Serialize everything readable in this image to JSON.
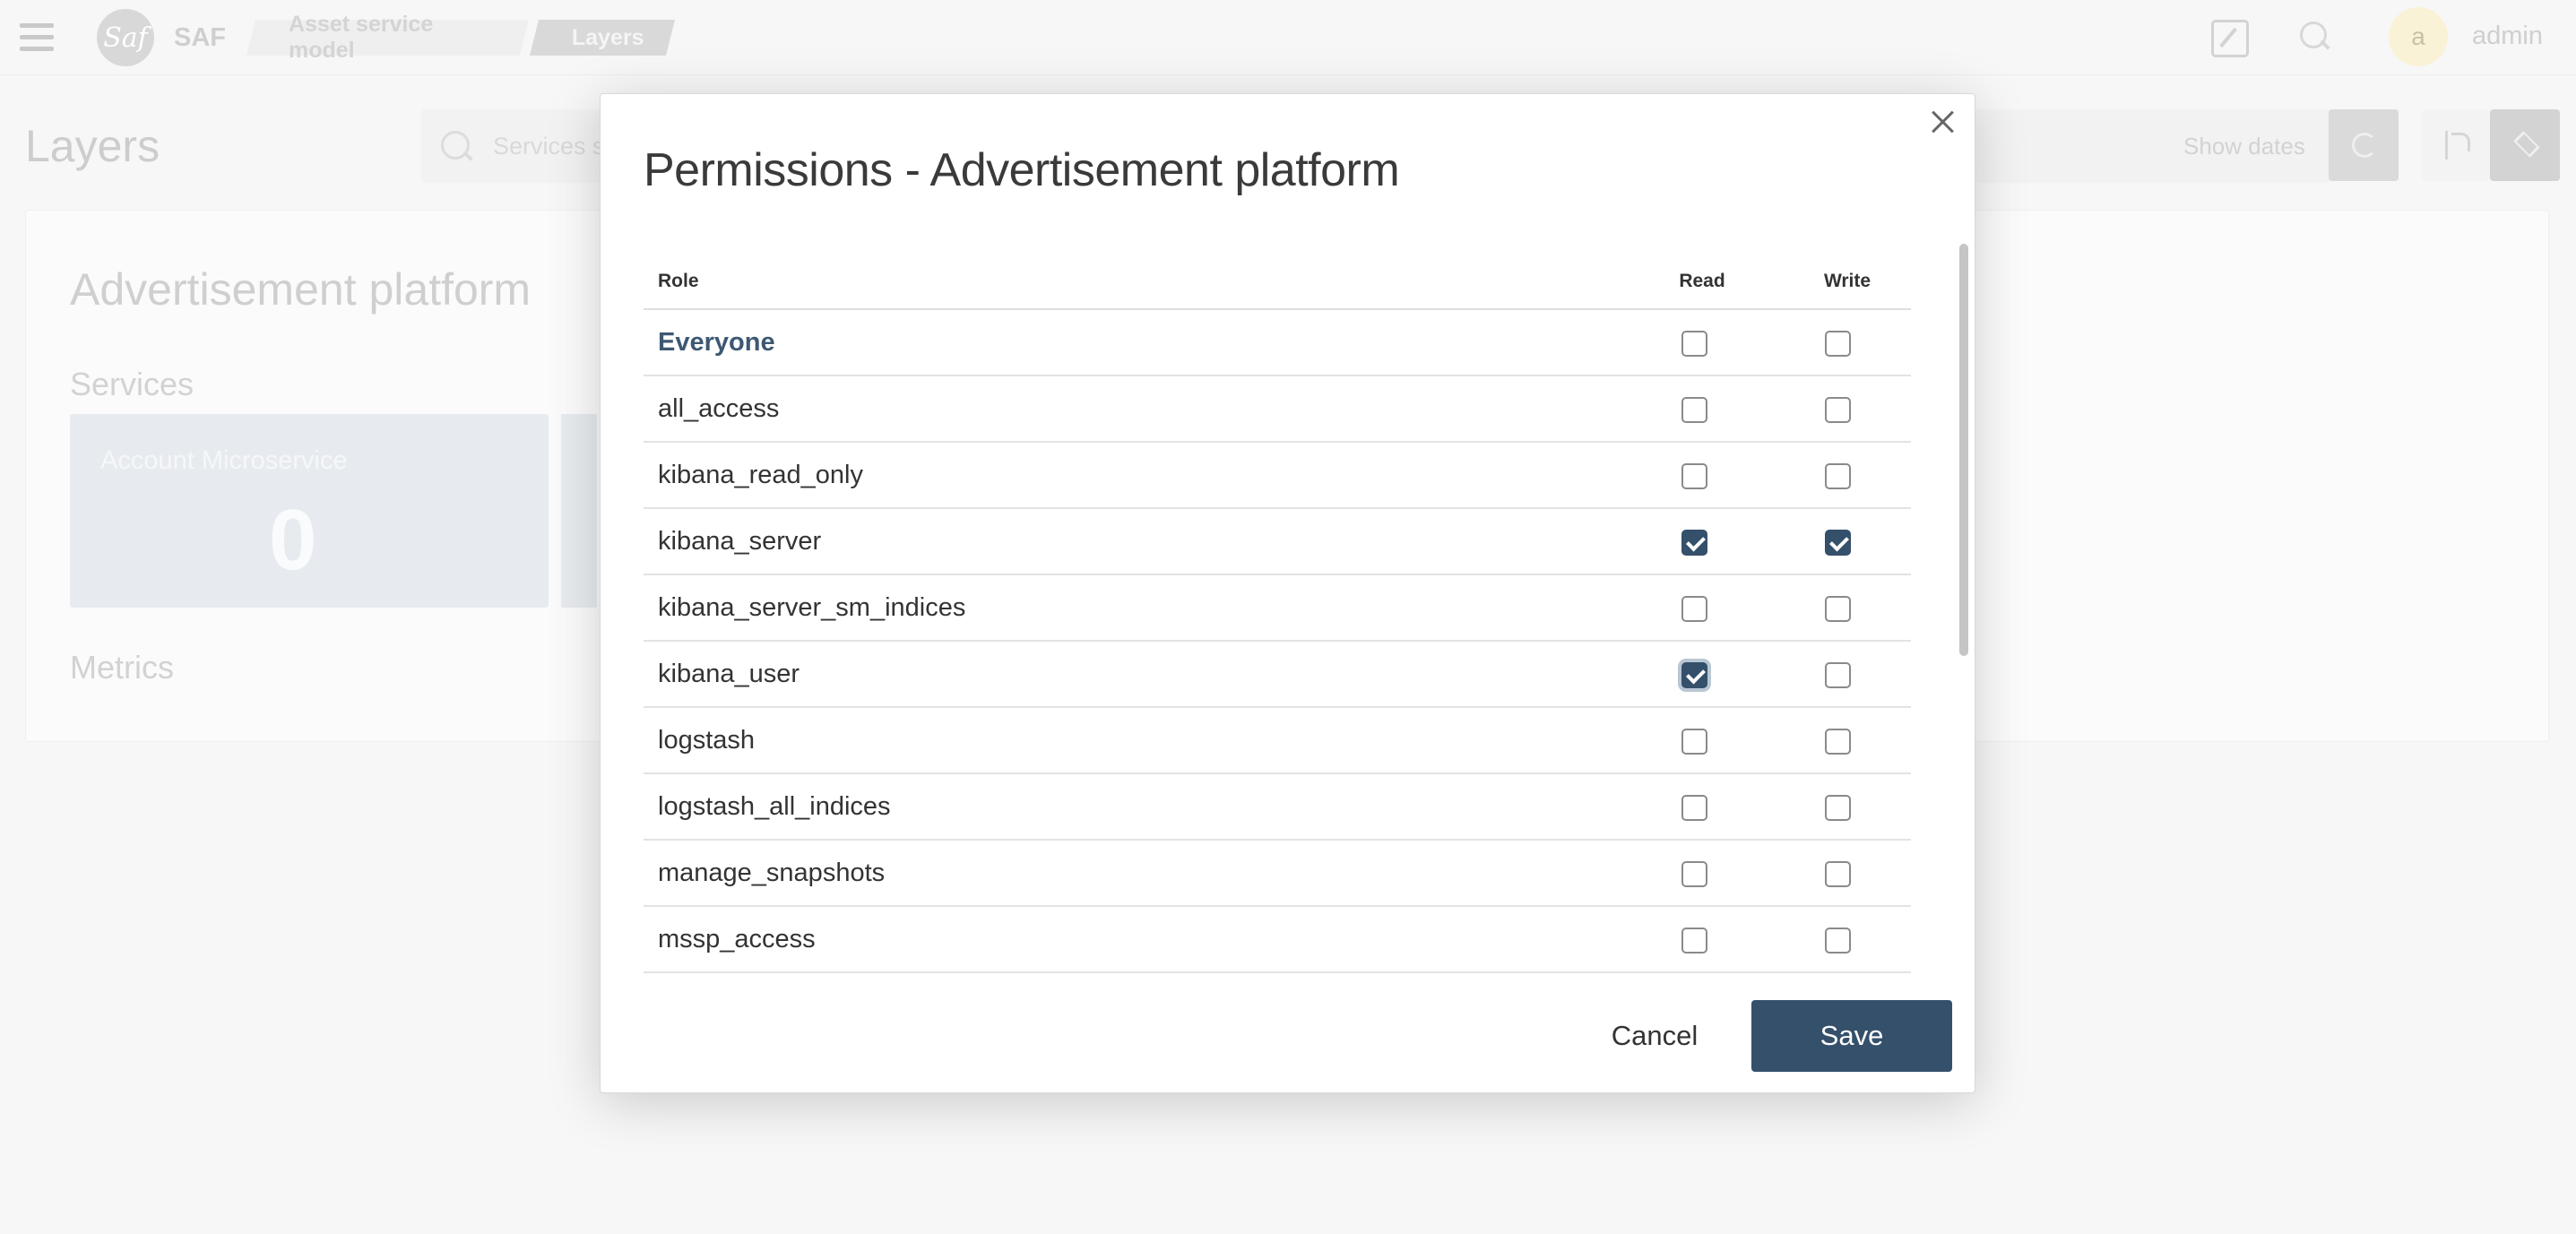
{
  "header": {
    "brand": "SAF",
    "logo_text": "Saf",
    "breadcrumb": [
      "Asset service model",
      "Layers"
    ],
    "avatar_initial": "a",
    "username": "admin"
  },
  "page": {
    "title": "Layers",
    "search_placeholder": "Services se",
    "show_dates": "Show dates"
  },
  "panel": {
    "title": "Advertisement platform",
    "services_heading": "Services",
    "service_card": {
      "name": "Account Microservice",
      "value": "0"
    },
    "metrics_heading": "Metrics"
  },
  "modal": {
    "title": "Permissions - Advertisement platform",
    "columns": {
      "role": "Role",
      "read": "Read",
      "write": "Write"
    },
    "rows": [
      {
        "role": "Everyone",
        "read": false,
        "write": false
      },
      {
        "role": "all_access",
        "read": false,
        "write": false
      },
      {
        "role": "kibana_read_only",
        "read": false,
        "write": false
      },
      {
        "role": "kibana_server",
        "read": true,
        "write": true
      },
      {
        "role": "kibana_server_sm_indices",
        "read": false,
        "write": false
      },
      {
        "role": "kibana_user",
        "read": true,
        "write": false
      },
      {
        "role": "logstash",
        "read": false,
        "write": false
      },
      {
        "role": "logstash_all_indices",
        "read": false,
        "write": false
      },
      {
        "role": "manage_snapshots",
        "read": false,
        "write": false
      },
      {
        "role": "mssp_access",
        "read": false,
        "write": false
      }
    ],
    "cancel_label": "Cancel",
    "save_label": "Save"
  },
  "colors": {
    "primary": "#34506b",
    "everyone_label": "#3d5873"
  }
}
